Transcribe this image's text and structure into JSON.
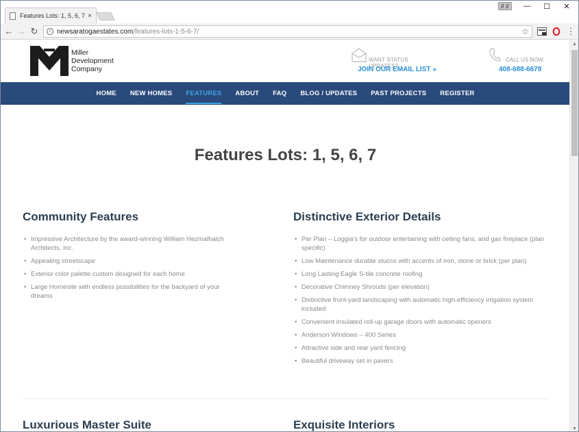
{
  "browser": {
    "tab_title": "Features Lots: 1, 5, 6, 7 -",
    "tab_close": "×",
    "profile_badge": "ℊℊ",
    "window_controls": {
      "minimize": "—",
      "maximize": "☐",
      "close": "✕"
    },
    "url_domain": "newsaratogaestates.com",
    "url_path": "/features-lots-1-5-6-7/",
    "nav": {
      "back": "←",
      "forward": "→",
      "reload": "↻",
      "star": "☆",
      "menu": "⋮"
    }
  },
  "site": {
    "logo_lines": [
      "Miller",
      "Development",
      "Company"
    ],
    "status": {
      "small": "WANT STATUS UPDATES?",
      "link": "JOIN OUR EMAIL LIST »"
    },
    "call": {
      "small": "CALL US NOW.",
      "phone": "408-688-6678"
    },
    "nav_items": [
      {
        "label": "HOME",
        "active": false
      },
      {
        "label": "NEW HOMES",
        "active": false
      },
      {
        "label": "FEATURES",
        "active": true
      },
      {
        "label": "ABOUT",
        "active": false
      },
      {
        "label": "FAQ",
        "active": false
      },
      {
        "label": "BLOG / UPDATES",
        "active": false
      },
      {
        "label": "PAST PROJECTS",
        "active": false
      },
      {
        "label": "REGISTER",
        "active": false
      }
    ],
    "accent_color": "#2a8ed6",
    "nav_bg_color": "#2a4a7b"
  },
  "content": {
    "page_title": "Features Lots: 1, 5, 6, 7",
    "community": {
      "heading": "Community Features",
      "items": [
        "Impressive Architecture by the award-winning William Hezmalhalch Architects, Inc.",
        "Appealing streetscape",
        "Exterior color palette custom designed for each home",
        "Large Homesite with endless possibilities for the backyard of your dreams"
      ]
    },
    "exterior": {
      "heading": "Distinctive Exterior Details",
      "items": [
        "Per Plan – Loggia's for outdoor entertaining with ceiling fans, and gas fireplace (plan specific)",
        "Low Maintenance durable stucco with accents of iron, stone or brick (per plan)",
        "Long Lasting Eagle S-tile concrete roofing",
        "Decorative Chimney Shrouds (per elevation)",
        "Distinctive front-yard landscaping with automatic high-efficiency irrigation system included",
        "Convenient insulated roll-up garage doors with automatic openers",
        "Anderson Windows – 400 Series",
        "Attractive side and rear yard fencing",
        "Beautiful driveway set in pavers"
      ]
    },
    "lower_left_heading": "Luxurious Master Suite",
    "lower_right_heading": "Exquisite Interiors"
  }
}
